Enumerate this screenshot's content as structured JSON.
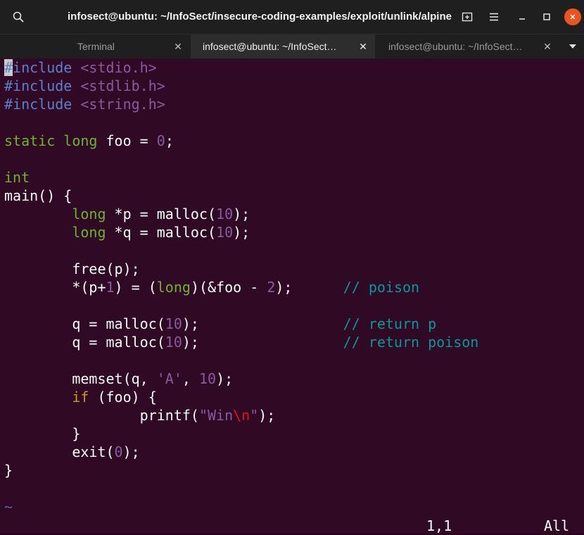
{
  "window": {
    "title": "infosect@ubuntu: ~/InfoSect/insecure-coding-examples/exploit/unlink/alpine"
  },
  "tabs": [
    {
      "label": "Terminal",
      "active": false
    },
    {
      "label": "infosect@ubuntu: ~/InfoSect…",
      "active": true
    },
    {
      "label": "infosect@ubuntu: ~/InfoSect…",
      "active": false
    }
  ],
  "icons": {
    "search": "search-icon",
    "new_tab": "new-tab-icon",
    "menu": "hamburger-menu-icon",
    "minimize": "minimize-icon",
    "maximize": "maximize-icon",
    "close": "close-icon",
    "tabs_menu": "chevron-down-icon"
  },
  "colors": {
    "terminal_bg": "#300a24",
    "close_button": "#e95420",
    "type_green": "#6eb32a",
    "preproc_blue": "#5c7fcf",
    "comment_teal": "#06989a",
    "constant_purple": "#8b5a9e",
    "keyword_yellow": "#c4a000",
    "escape_red": "#d8151b"
  },
  "code": {
    "l1": {
      "cursor": "#",
      "kw": "include",
      "arg": "<stdio.h>"
    },
    "l2": {
      "kw": "#include",
      "arg": "<stdlib.h>"
    },
    "l3": {
      "kw": "#include",
      "arg": "<string.h>"
    },
    "l5": {
      "static": "static",
      "long": "long",
      "rest": "foo = ",
      "num": "0",
      "end": ";"
    },
    "l7": {
      "type": "int"
    },
    "l8": {
      "text": "main() {"
    },
    "l9": {
      "type": "long",
      "mid": "*p = malloc(",
      "num": "10",
      "end": ");"
    },
    "l10": {
      "type": "long",
      "mid": "*q = malloc(",
      "num": "10",
      "end": ");"
    },
    "l12": {
      "text": "free(p);"
    },
    "l13": {
      "a": "*(p+",
      "num1": "1",
      "b": ") = (",
      "type": "long",
      "c": ")(&foo - ",
      "num2": "2",
      "d": ");",
      "comment": "// poison"
    },
    "l15": {
      "a": "q = malloc(",
      "num": "10",
      "b": ");",
      "comment": "// return p"
    },
    "l16": {
      "a": "q = malloc(",
      "num": "10",
      "b": ");",
      "comment": "// return poison"
    },
    "l18": {
      "a": "memset(q, ",
      "str": "'A'",
      "b": ", ",
      "num": "10",
      "c": ");"
    },
    "l19": {
      "kw": "if",
      "rest": " (foo) {"
    },
    "l20": {
      "a": "printf(",
      "str1": "\"Win",
      "esc": "\\n",
      "str2": "\"",
      "b": ");"
    },
    "l21": {
      "text": "}"
    },
    "l22": {
      "a": "exit(",
      "num": "0",
      "b": ");"
    },
    "l23": {
      "text": "}"
    },
    "tilde": "~"
  },
  "status": {
    "position": "1,1",
    "scroll": "All"
  }
}
